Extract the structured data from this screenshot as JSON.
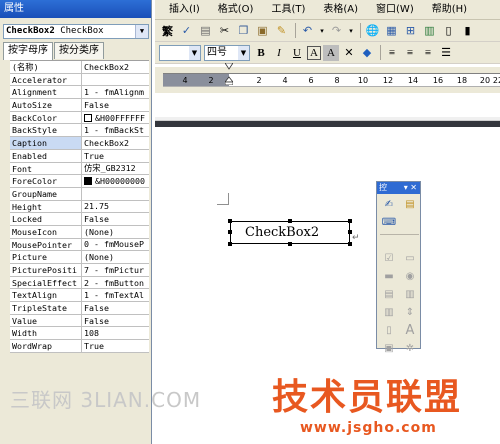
{
  "properties": {
    "title": "属性",
    "object_name": "CheckBox2",
    "object_type": "CheckBox",
    "tabs": [
      "按字母序",
      "按分类序"
    ],
    "rows": [
      {
        "key": "(名称)",
        "value": "CheckBox2"
      },
      {
        "key": "Accelerator",
        "value": ""
      },
      {
        "key": "Alignment",
        "value": "1 - fmAlignm"
      },
      {
        "key": "AutoSize",
        "value": "False"
      },
      {
        "key": "BackColor",
        "value": "&H00FFFFFF",
        "swatch": "#ffffff"
      },
      {
        "key": "BackStyle",
        "value": "1 - fmBackSt"
      },
      {
        "key": "Caption",
        "value": "CheckBox2"
      },
      {
        "key": "Enabled",
        "value": "True"
      },
      {
        "key": "Font",
        "value": "仿宋_GB2312"
      },
      {
        "key": "ForeColor",
        "value": "&H00000000",
        "swatch": "#000000"
      },
      {
        "key": "GroupName",
        "value": ""
      },
      {
        "key": "Height",
        "value": "21.75"
      },
      {
        "key": "Locked",
        "value": "False"
      },
      {
        "key": "MouseIcon",
        "value": "(None)"
      },
      {
        "key": "MousePointer",
        "value": "0 - fmMouseP"
      },
      {
        "key": "Picture",
        "value": "(None)"
      },
      {
        "key": "PicturePositi",
        "value": "7 - fmPictur"
      },
      {
        "key": "SpecialEffect",
        "value": "2 - fmButton"
      },
      {
        "key": "TextAlign",
        "value": "1 - fmTextAl"
      },
      {
        "key": "TripleState",
        "value": "False"
      },
      {
        "key": "Value",
        "value": "False"
      },
      {
        "key": "Width",
        "value": "108"
      },
      {
        "key": "WordWrap",
        "value": "True"
      }
    ]
  },
  "menu": [
    "插入(I)",
    "格式(O)",
    "工具(T)",
    "表格(A)",
    "窗口(W)",
    "帮助(H)"
  ],
  "format_toolbar": {
    "font_size_label": "四号",
    "bold": "B",
    "italic": "I",
    "underline": "U",
    "border_a": "A"
  },
  "ruler": {
    "numbers": [
      "4",
      "2",
      "2",
      "4",
      "6",
      "8",
      "10",
      "12",
      "14",
      "16",
      "18",
      "20",
      "22"
    ]
  },
  "document": {
    "checkbox_caption": "CheckBox2"
  },
  "toolbox": {
    "title": "控"
  },
  "watermarks": {
    "left": "三联网 3LIAN.COM",
    "brand": "技术员联盟",
    "url": "www.jsgho.com"
  },
  "colors": {
    "title_bar": "#2d6fd6",
    "watermark": "#e85820"
  }
}
